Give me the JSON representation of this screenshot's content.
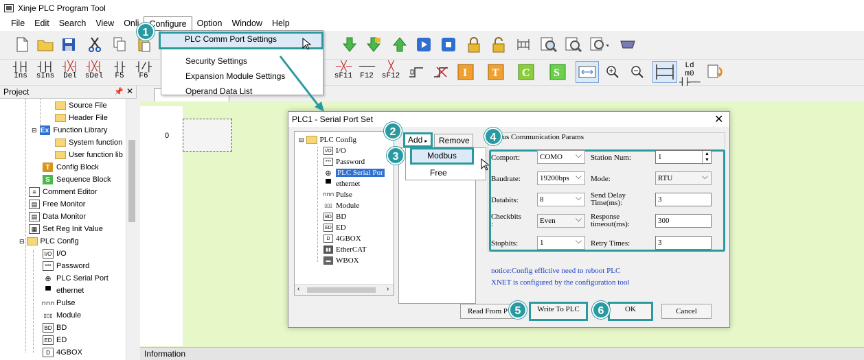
{
  "window": {
    "title": "Xinje PLC Program Tool"
  },
  "menubar": {
    "items": [
      "File",
      "Edit",
      "Search",
      "View",
      "Onli",
      "Configure",
      "Option",
      "Window",
      "Help"
    ]
  },
  "toolbar2": {
    "labels": [
      "Ins",
      "sIns",
      "Del",
      "sDel",
      "F5",
      "F6",
      "sF11",
      "F12",
      "sF12",
      "Ld m0"
    ]
  },
  "project": {
    "header": "Project",
    "items": [
      "Source File",
      "Header File",
      "Function Library",
      "System function",
      "User function lib",
      "Config Block",
      "Sequence Block",
      "Comment Editor",
      "Free Monitor",
      "Data Monitor",
      "Set Reg Init Value",
      "PLC Config",
      "I/O",
      "Password",
      "PLC Serial Port",
      "ethernet",
      "Pulse",
      "Module",
      "BD",
      "ED",
      "4GBOX"
    ]
  },
  "ladder": {
    "rung_number": "0"
  },
  "info_bar": {
    "label": "Information"
  },
  "configure_menu": {
    "items": [
      "PLC Comm Port Settings",
      "Security Settings",
      "Expansion Module Settings",
      "Operand Data List"
    ]
  },
  "dialog": {
    "title": "PLC1 - Serial Port  Set",
    "tree": [
      "PLC Config",
      "I/O",
      "Password",
      "PLC Serial Por",
      "ethernet",
      "Pulse",
      "Module",
      "BD",
      "ED",
      "4GBOX",
      "EtherCAT",
      "WBOX"
    ],
    "add_label": "Add",
    "remove_label": "Remove",
    "add_menu": [
      "Modbus",
      "Free"
    ],
    "params_title": "bus Communication Params",
    "labels": {
      "comport": "Comport:",
      "station": "Station Num:",
      "baudrate": "Baudrate:",
      "mode": "Mode:",
      "databits": "Databits:",
      "send_delay_1": "Send Delay",
      "send_delay_2": "Time(ms):",
      "checkbits_1": "Checkbits",
      "checkbits_2": ":",
      "response_1": "Response",
      "response_2": "timeout(ms):",
      "stopbits": "Stopbits:",
      "retry": "Retry Times:"
    },
    "values": {
      "comport": "COMO",
      "station": "1",
      "baudrate": "19200bps",
      "mode": "RTU",
      "databits": "8",
      "send_delay": "3",
      "checkbits": "Even",
      "response": "300",
      "stopbits": "1",
      "retry": "3"
    },
    "notice1": "notice:Config effictive need to reboot PLC",
    "notice2": "XNET is configured by the configuration tool",
    "buttons": {
      "read": "Read From P",
      "write": "Write To PLC",
      "ok": "OK",
      "cancel": "Cancel"
    }
  },
  "steps": [
    "1",
    "2",
    "3",
    "4",
    "5",
    "6"
  ],
  "colors": {
    "highlight": "#2b9aa0",
    "ladder_bg": "#e6f7c8",
    "notice": "#1a3ec8"
  }
}
